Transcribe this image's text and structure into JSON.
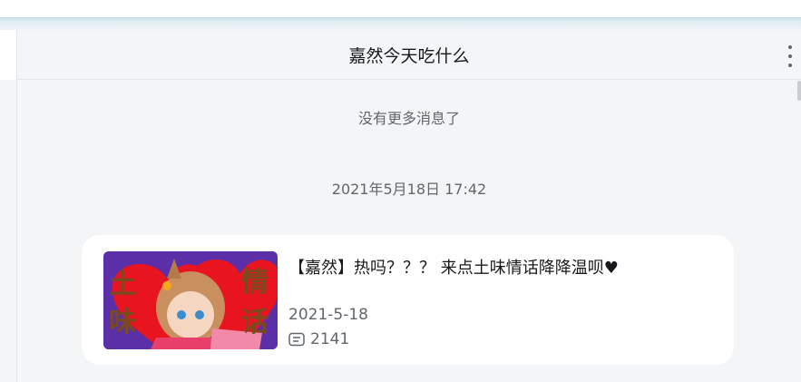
{
  "chat": {
    "title": "嘉然今天吃什么",
    "no_more_text": "没有更多消息了",
    "timestamp": "2021年5月18日 17:42"
  },
  "card": {
    "title": "【嘉然】热吗？？？ 来点土味情话降降温呗♥",
    "date": "2021-5-18",
    "danmaku_count": "2141",
    "cover_text": [
      "土",
      "味",
      "情",
      "话"
    ],
    "cover_colors": {
      "background": "#5a2fa8",
      "heart": "#e8141f",
      "lettering": "#7a4a1e"
    }
  },
  "icons": {
    "more": "more-vertical-icon",
    "danmaku": "danmaku-icon"
  }
}
